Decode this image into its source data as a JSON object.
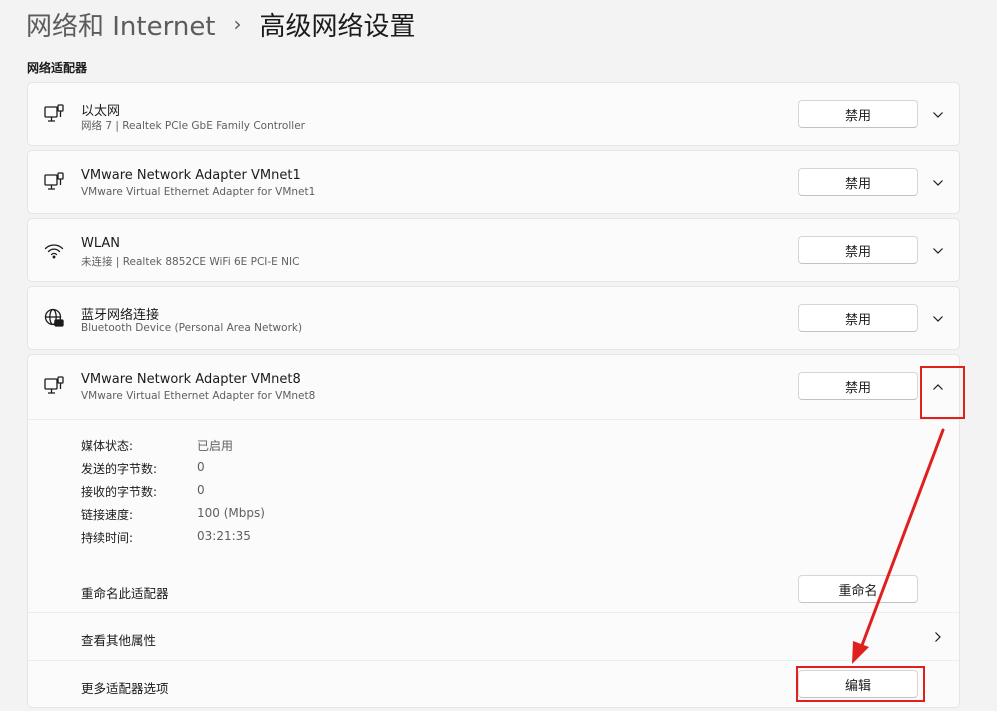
{
  "breadcrumb": {
    "parent": "网络和 Internet",
    "separator": "›",
    "current": "高级网络设置"
  },
  "section": {
    "label": "网络适配器"
  },
  "adapters": [
    {
      "name": "以太网",
      "description": "网络 7 | Realtek PCIe GbE Family Controller",
      "icon": "ethernet-icon",
      "button": "禁用",
      "expanded": false
    },
    {
      "name": "VMware Network Adapter VMnet1",
      "description": "VMware Virtual Ethernet Adapter for VMnet1",
      "icon": "ethernet-icon",
      "button": "禁用",
      "expanded": false
    },
    {
      "name": "WLAN",
      "description": "未连接 | Realtek 8852CE WiFi 6E PCI-E NIC",
      "icon": "wifi-icon",
      "button": "禁用",
      "expanded": false
    },
    {
      "name": "蓝牙网络连接",
      "description": "Bluetooth Device (Personal Area Network)",
      "icon": "globe-icon",
      "button": "禁用",
      "expanded": false
    },
    {
      "name": "VMware Network Adapter VMnet8",
      "description": "VMware Virtual Ethernet Adapter for VMnet8",
      "icon": "ethernet-icon",
      "button": "禁用",
      "expanded": true
    }
  ],
  "details": {
    "media_status": {
      "label": "媒体状态:",
      "value": "已启用"
    },
    "bytes_sent": {
      "label": "发送的字节数:",
      "value": "0"
    },
    "bytes_received": {
      "label": "接收的字节数:",
      "value": "0"
    },
    "link_speed": {
      "label": "链接速度:",
      "value": "100 (Mbps)"
    },
    "duration": {
      "label": "持续时间:",
      "value": "03:21:35"
    }
  },
  "actions": {
    "rename": {
      "label": "重命名此适配器",
      "button": "重命名"
    },
    "properties": {
      "label": "查看其他属性"
    },
    "more_options": {
      "label": "更多适配器选项",
      "button": "编辑"
    }
  },
  "colors": {
    "annotation": "#e0201f",
    "background": "#f3f3f3",
    "card": "#fbfbfb"
  }
}
